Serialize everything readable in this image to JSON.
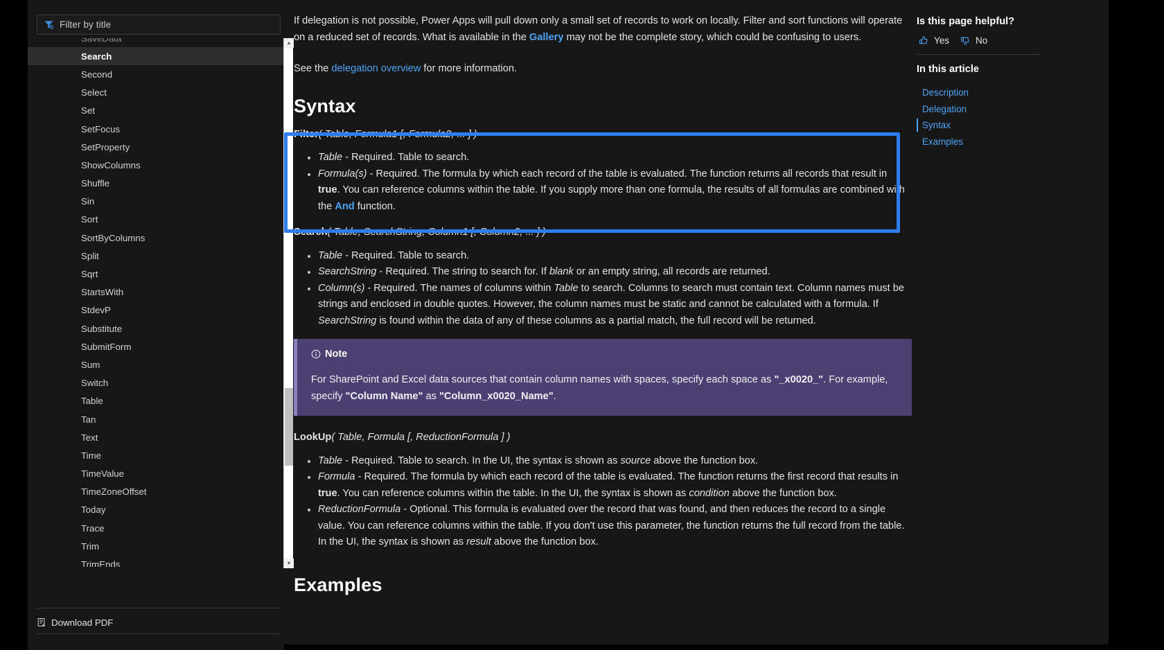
{
  "sidebar": {
    "filter": {
      "placeholder": "Filter by title",
      "icon": "filter-icon"
    },
    "items": [
      {
        "label": "SaveData",
        "state": "partial-top"
      },
      {
        "label": "Search",
        "state": "active"
      },
      {
        "label": "Second",
        "state": "normal"
      },
      {
        "label": "Select",
        "state": "normal"
      },
      {
        "label": "Set",
        "state": "normal"
      },
      {
        "label": "SetFocus",
        "state": "normal"
      },
      {
        "label": "SetProperty",
        "state": "normal"
      },
      {
        "label": "ShowColumns",
        "state": "normal"
      },
      {
        "label": "Shuffle",
        "state": "normal"
      },
      {
        "label": "Sin",
        "state": "normal"
      },
      {
        "label": "Sort",
        "state": "normal"
      },
      {
        "label": "SortByColumns",
        "state": "normal"
      },
      {
        "label": "Split",
        "state": "normal"
      },
      {
        "label": "Sqrt",
        "state": "normal"
      },
      {
        "label": "StartsWith",
        "state": "normal"
      },
      {
        "label": "StdevP",
        "state": "normal"
      },
      {
        "label": "Substitute",
        "state": "normal"
      },
      {
        "label": "SubmitForm",
        "state": "normal"
      },
      {
        "label": "Sum",
        "state": "normal"
      },
      {
        "label": "Switch",
        "state": "normal"
      },
      {
        "label": "Table",
        "state": "normal"
      },
      {
        "label": "Tan",
        "state": "normal"
      },
      {
        "label": "Text",
        "state": "normal"
      },
      {
        "label": "Time",
        "state": "normal"
      },
      {
        "label": "TimeValue",
        "state": "normal"
      },
      {
        "label": "TimeZoneOffset",
        "state": "normal"
      },
      {
        "label": "Today",
        "state": "normal"
      },
      {
        "label": "Trace",
        "state": "normal"
      },
      {
        "label": "Trim",
        "state": "normal"
      },
      {
        "label": "TrimEnds",
        "state": "partial-bottom"
      }
    ],
    "download_pdf": "Download PDF",
    "scrollbar": {
      "up_arrow": "▲",
      "down_arrow": "▼"
    }
  },
  "main": {
    "intro_paragraph_1": {
      "part1": "If delegation is not possible, Power Apps will pull down only a small set of records to work on locally. Filter and sort functions will operate on a reduced set of records. What is available in the ",
      "link": "Gallery",
      "part2": " may not be the complete story, which could be confusing to users."
    },
    "intro_paragraph_2": {
      "part1": "See the ",
      "link": "delegation overview",
      "part2": " for more information."
    },
    "syntax_heading": "Syntax",
    "filter": {
      "signature_name": "Filter",
      "signature_args": "( Table, Formula1 [, Formula2, ... ] )",
      "params": [
        {
          "name": "Table",
          "text": " - Required. Table to search."
        },
        {
          "name": "Formula(s)",
          "text_a": " - Required. The formula by which each record of the table is evaluated. The function returns all records that result in ",
          "bold": "true",
          "text_b": ". You can reference columns within the table. If you supply more than one formula, the results of all formulas are combined with the ",
          "link": "And",
          "text_c": " function."
        }
      ]
    },
    "search": {
      "signature_name": "Search",
      "signature_args": "( Table, SearchString, Column1 [, Column2, ... ] )",
      "params": [
        {
          "name": "Table",
          "text": " - Required. Table to search."
        },
        {
          "name": "SearchString",
          "text_a": " - Required. The string to search for. If ",
          "em": "blank",
          "text_b": " or an empty string, all records are returned."
        },
        {
          "name": "Column(s)",
          "text_a": " - Required. The names of columns within ",
          "em1": "Table",
          "text_b": " to search. Columns to search must contain text. Column names must be strings and enclosed in double quotes. However, the column names must be static and cannot be calculated with a formula. If ",
          "em2": "SearchString",
          "text_c": " is found within the data of any of these columns as a partial match, the full record will be returned."
        }
      ]
    },
    "note": {
      "title": "Note",
      "icon": "info-icon",
      "text_a": "For SharePoint and Excel data sources that contain column names with spaces, specify each space as ",
      "code1": "\"_x0020_\"",
      "text_b": ". For example, specify ",
      "code2": "\"Column Name\"",
      "text_c": " as ",
      "code3": "\"Column_x0020_Name\"",
      "text_d": "."
    },
    "lookup": {
      "signature_name": "LookUp",
      "signature_args": "( Table, Formula [, ReductionFormula ] )",
      "params": [
        {
          "name": "Table",
          "text_a": " - Required. Table to search. In the UI, the syntax is shown as ",
          "em": "source",
          "text_b": " above the function box."
        },
        {
          "name": "Formula",
          "text_a": " - Required. The formula by which each record of the table is evaluated. The function returns the first record that results in ",
          "bold": "true",
          "text_b": ". You can reference columns within the table. In the UI, the syntax is shown as ",
          "em": "condition",
          "text_c": " above the function box."
        },
        {
          "name": "ReductionFormula",
          "text_a": " - Optional. This formula is evaluated over the record that was found, and then reduces the record to a single value. You can reference columns within the table. If you don't use this parameter, the function returns the full record from the table. In the UI, the syntax is shown as ",
          "em": "result",
          "text_b": " above the function box."
        }
      ]
    },
    "examples_heading": "Examples"
  },
  "right_sidebar": {
    "feedback_title": "Is this page helpful?",
    "yes_label": "Yes",
    "no_label": "No",
    "thumbs_up_icon": "thumbs-up-icon",
    "thumbs_down_icon": "thumbs-down-icon",
    "in_this_article": "In this article",
    "links": [
      {
        "label": "Description",
        "current": false
      },
      {
        "label": "Delegation",
        "current": false
      },
      {
        "label": "Syntax",
        "current": true
      },
      {
        "label": "Examples",
        "current": false
      }
    ]
  },
  "colors": {
    "background": "#171717",
    "accent_link": "#4ea3f5",
    "highlight_box": "#2f7ef0",
    "note_bg": "#4c3f72",
    "active_item_bg": "#2e2e2e"
  }
}
